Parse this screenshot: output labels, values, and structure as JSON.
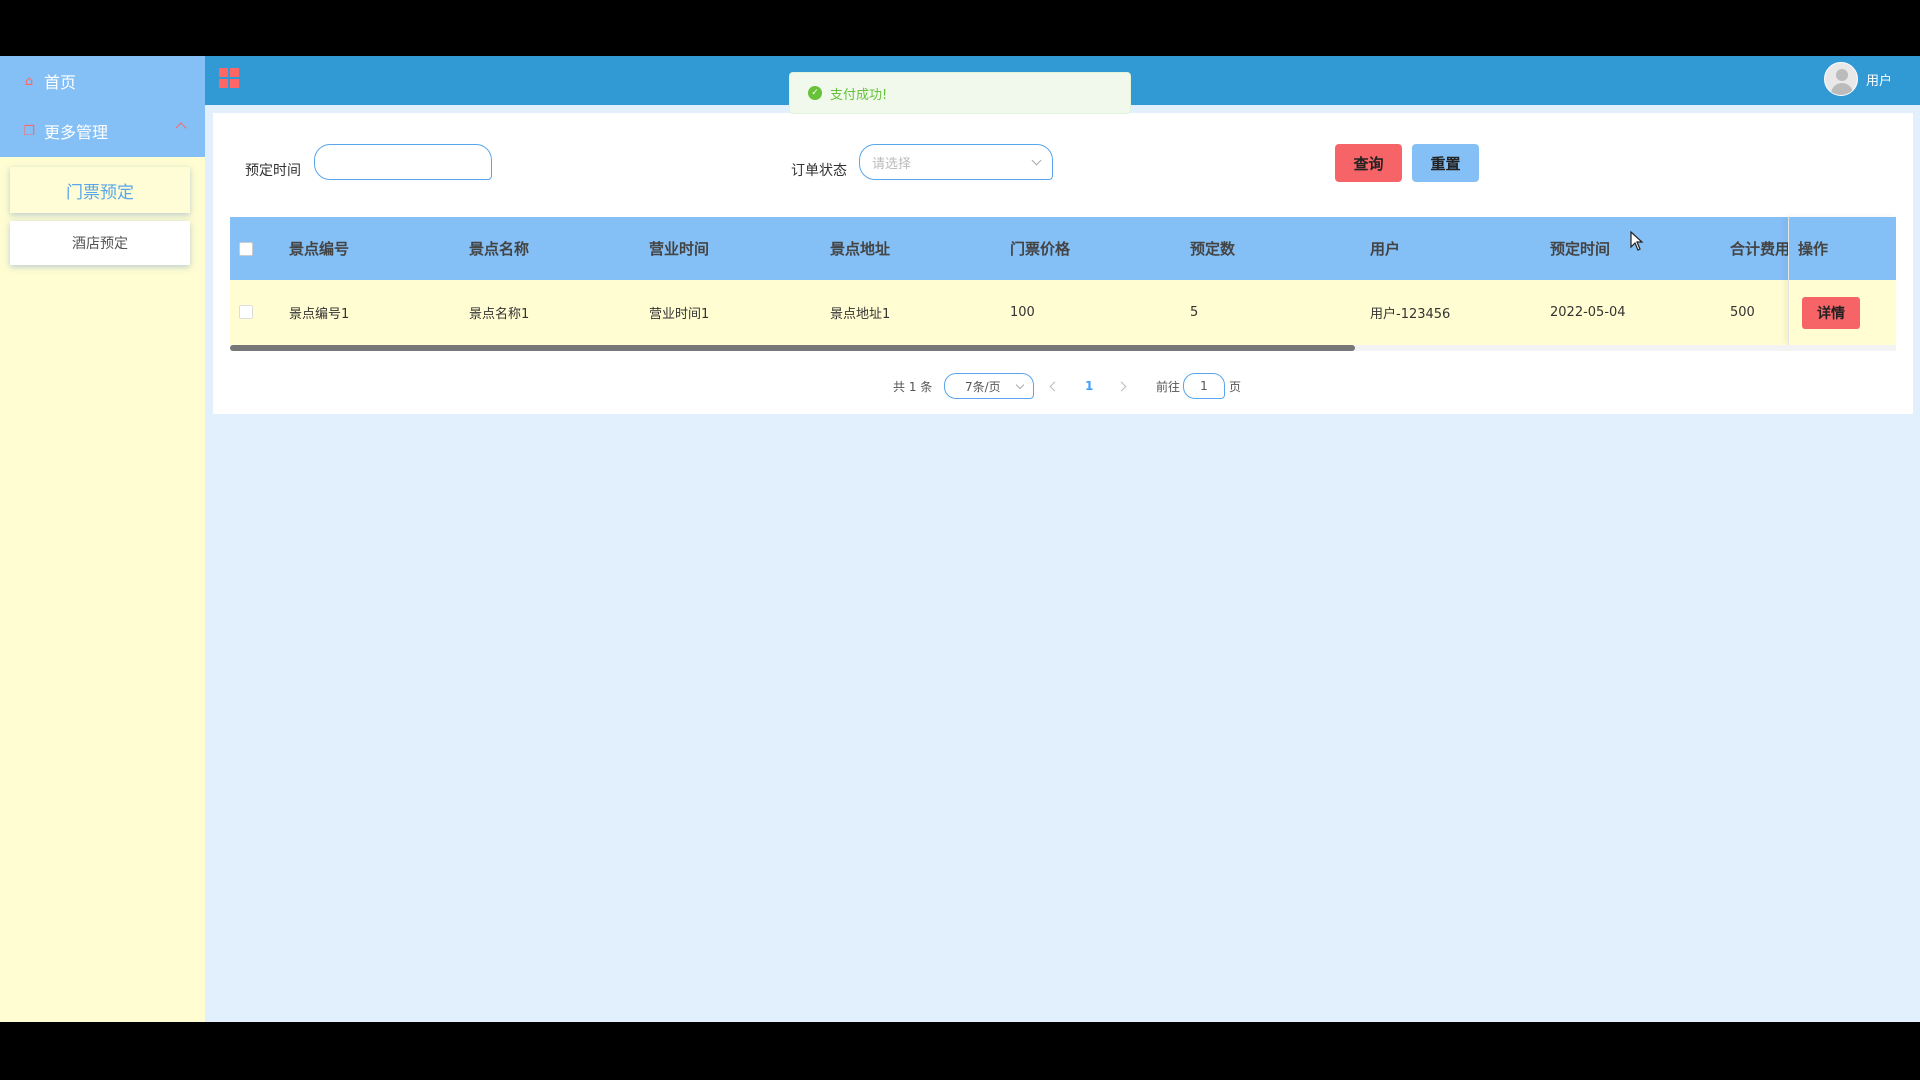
{
  "sidebar": {
    "home_label": "首页",
    "home_icon": "home-icon",
    "more_label": "更多管理",
    "more_icon": "copy-icon",
    "sub_items": [
      "门票预定",
      "酒店预定"
    ]
  },
  "header": {
    "menu_icon": "grid-icon",
    "user_label": "用户"
  },
  "toast": {
    "message": "支付成功!",
    "icon": "check-circle-icon"
  },
  "filters": {
    "date_label": "预定时间",
    "date_value": "",
    "status_label": "订单状态",
    "status_placeholder": "请选择",
    "search_button": "查询",
    "reset_button": "重置"
  },
  "table": {
    "columns": [
      "景点编号",
      "景点名称",
      "营业时间",
      "景点地址",
      "门票价格",
      "预定数",
      "用户",
      "预定时间",
      "合计费用",
      "操作"
    ],
    "rows": [
      {
        "spot_id": "景点编号1",
        "spot_name": "景点名称1",
        "hours": "营业时间1",
        "address": "景点地址1",
        "price": "100",
        "count": "5",
        "user": "用户-123456",
        "date": "2022-05-04",
        "total": "500",
        "action": "详情"
      }
    ]
  },
  "pagination": {
    "total_text": "共 1 条",
    "page_size": "7条/页",
    "current_page": "1",
    "goto_label": "前往",
    "goto_value": "1",
    "page_suffix": "页"
  },
  "colors": {
    "sidebar_bg": "#fffdd1",
    "sidebar_top": "#84bff5",
    "header_bg": "#3199d3",
    "main_bg": "#e2f0fd",
    "accent_red": "#f66468",
    "accent_blue": "#84bff5"
  }
}
